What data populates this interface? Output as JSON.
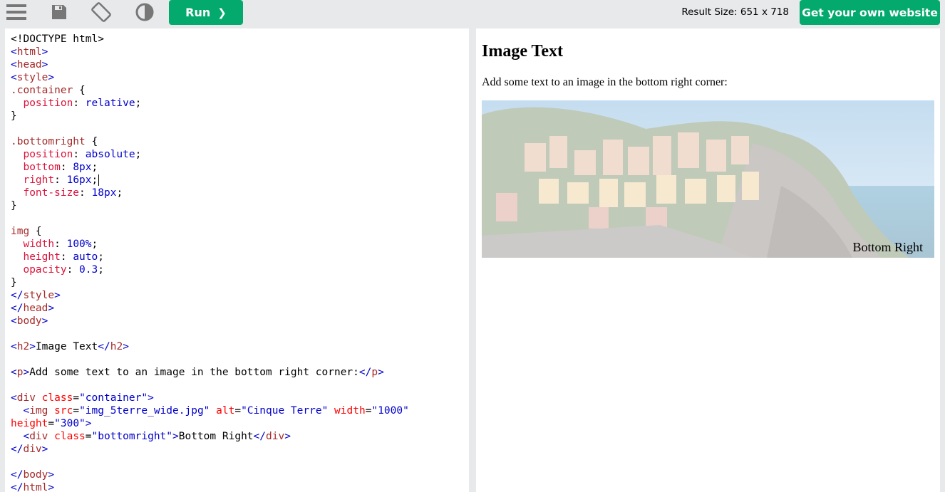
{
  "toolbar": {
    "menu_icon": "hamburger-menu-icon",
    "save_icon": "save-icon",
    "rotate_icon": "rotate-icon",
    "theme_icon": "contrast-icon",
    "run_label": "Run",
    "run_chevron": "❯",
    "result_size": "Result Size: 651 x 718",
    "get_website_label": "Get your own website",
    "accent_color": "#04aa6d"
  },
  "editor": {
    "lines": [
      [
        {
          "c": "",
          "t": "<!DOCTYPE html>"
        }
      ],
      [
        {
          "c": "b",
          "t": "<"
        },
        {
          "c": "t",
          "t": "html"
        },
        {
          "c": "b",
          "t": ">"
        }
      ],
      [
        {
          "c": "b",
          "t": "<"
        },
        {
          "c": "t",
          "t": "head"
        },
        {
          "c": "b",
          "t": ">"
        }
      ],
      [
        {
          "c": "b",
          "t": "<"
        },
        {
          "c": "t",
          "t": "style"
        },
        {
          "c": "b",
          "t": ">"
        }
      ],
      [
        {
          "c": "t",
          "t": ".container"
        },
        {
          "c": "",
          "t": " {"
        }
      ],
      [
        {
          "c": "",
          "t": "  "
        },
        {
          "c": "p",
          "t": "position"
        },
        {
          "c": "",
          "t": ": "
        },
        {
          "c": "b",
          "t": "relative"
        },
        {
          "c": "",
          "t": ";"
        }
      ],
      [
        {
          "c": "",
          "t": "}"
        }
      ],
      [
        {
          "c": "",
          "t": ""
        }
      ],
      [
        {
          "c": "t",
          "t": ".bottomright"
        },
        {
          "c": "",
          "t": " {"
        }
      ],
      [
        {
          "c": "",
          "t": "  "
        },
        {
          "c": "p",
          "t": "position"
        },
        {
          "c": "",
          "t": ": "
        },
        {
          "c": "b",
          "t": "absolute"
        },
        {
          "c": "",
          "t": ";"
        }
      ],
      [
        {
          "c": "",
          "t": "  "
        },
        {
          "c": "p",
          "t": "bottom"
        },
        {
          "c": "",
          "t": ": "
        },
        {
          "c": "b",
          "t": "8px"
        },
        {
          "c": "",
          "t": ";"
        }
      ],
      [
        {
          "c": "",
          "t": "  "
        },
        {
          "c": "p",
          "t": "right"
        },
        {
          "c": "",
          "t": ": "
        },
        {
          "c": "b",
          "t": "16px"
        },
        {
          "c": "",
          "t": ";"
        },
        {
          "c": "cursor",
          "t": ""
        }
      ],
      [
        {
          "c": "",
          "t": "  "
        },
        {
          "c": "p",
          "t": "font-size"
        },
        {
          "c": "",
          "t": ": "
        },
        {
          "c": "b",
          "t": "18px"
        },
        {
          "c": "",
          "t": ";"
        }
      ],
      [
        {
          "c": "",
          "t": "}"
        }
      ],
      [
        {
          "c": "",
          "t": ""
        }
      ],
      [
        {
          "c": "t",
          "t": "img"
        },
        {
          "c": "",
          "t": " {"
        }
      ],
      [
        {
          "c": "",
          "t": "  "
        },
        {
          "c": "p",
          "t": "width"
        },
        {
          "c": "",
          "t": ": "
        },
        {
          "c": "b",
          "t": "100%"
        },
        {
          "c": "",
          "t": ";"
        }
      ],
      [
        {
          "c": "",
          "t": "  "
        },
        {
          "c": "p",
          "t": "height"
        },
        {
          "c": "",
          "t": ": "
        },
        {
          "c": "b",
          "t": "auto"
        },
        {
          "c": "",
          "t": ";"
        }
      ],
      [
        {
          "c": "",
          "t": "  "
        },
        {
          "c": "p",
          "t": "opacity"
        },
        {
          "c": "",
          "t": ": "
        },
        {
          "c": "b",
          "t": "0.3"
        },
        {
          "c": "",
          "t": ";"
        }
      ],
      [
        {
          "c": "",
          "t": "}"
        }
      ],
      [
        {
          "c": "b",
          "t": "</"
        },
        {
          "c": "t",
          "t": "style"
        },
        {
          "c": "b",
          "t": ">"
        }
      ],
      [
        {
          "c": "b",
          "t": "</"
        },
        {
          "c": "t",
          "t": "head"
        },
        {
          "c": "b",
          "t": ">"
        }
      ],
      [
        {
          "c": "b",
          "t": "<"
        },
        {
          "c": "t",
          "t": "body"
        },
        {
          "c": "b",
          "t": ">"
        }
      ],
      [
        {
          "c": "",
          "t": ""
        }
      ],
      [
        {
          "c": "b",
          "t": "<"
        },
        {
          "c": "t",
          "t": "h2"
        },
        {
          "c": "b",
          "t": ">"
        },
        {
          "c": "",
          "t": "Image Text"
        },
        {
          "c": "b",
          "t": "</"
        },
        {
          "c": "t",
          "t": "h2"
        },
        {
          "c": "b",
          "t": ">"
        }
      ],
      [
        {
          "c": "",
          "t": ""
        }
      ],
      [
        {
          "c": "b",
          "t": "<"
        },
        {
          "c": "t",
          "t": "p"
        },
        {
          "c": "b",
          "t": ">"
        },
        {
          "c": "",
          "t": "Add some text to an image in the bottom right corner:"
        },
        {
          "c": "b",
          "t": "</"
        },
        {
          "c": "t",
          "t": "p"
        },
        {
          "c": "b",
          "t": ">"
        }
      ],
      [
        {
          "c": "",
          "t": ""
        }
      ],
      [
        {
          "c": "b",
          "t": "<"
        },
        {
          "c": "t",
          "t": "div"
        },
        {
          "c": "",
          "t": " "
        },
        {
          "c": "a",
          "t": "class"
        },
        {
          "c": "",
          "t": "="
        },
        {
          "c": "b",
          "t": "\"container\""
        },
        {
          "c": "b",
          "t": ">"
        }
      ],
      [
        {
          "c": "",
          "t": "  "
        },
        {
          "c": "b",
          "t": "<"
        },
        {
          "c": "t",
          "t": "img"
        },
        {
          "c": "",
          "t": " "
        },
        {
          "c": "a",
          "t": "src"
        },
        {
          "c": "",
          "t": "="
        },
        {
          "c": "b",
          "t": "\"img_5terre_wide.jpg\""
        },
        {
          "c": "",
          "t": " "
        },
        {
          "c": "a",
          "t": "alt"
        },
        {
          "c": "",
          "t": "="
        },
        {
          "c": "b",
          "t": "\"Cinque Terre\""
        },
        {
          "c": "",
          "t": " "
        },
        {
          "c": "a",
          "t": "width"
        },
        {
          "c": "",
          "t": "="
        },
        {
          "c": "b",
          "t": "\"1000\""
        }
      ],
      [
        {
          "c": "a",
          "t": "height"
        },
        {
          "c": "",
          "t": "="
        },
        {
          "c": "b",
          "t": "\"300\""
        },
        {
          "c": "b",
          "t": ">"
        }
      ],
      [
        {
          "c": "",
          "t": "  "
        },
        {
          "c": "b",
          "t": "<"
        },
        {
          "c": "t",
          "t": "div"
        },
        {
          "c": "",
          "t": " "
        },
        {
          "c": "a",
          "t": "class"
        },
        {
          "c": "",
          "t": "="
        },
        {
          "c": "b",
          "t": "\"bottomright\""
        },
        {
          "c": "b",
          "t": ">"
        },
        {
          "c": "",
          "t": "Bottom Right"
        },
        {
          "c": "b",
          "t": "</"
        },
        {
          "c": "t",
          "t": "div"
        },
        {
          "c": "b",
          "t": ">"
        }
      ],
      [
        {
          "c": "b",
          "t": "</"
        },
        {
          "c": "t",
          "t": "div"
        },
        {
          "c": "b",
          "t": ">"
        }
      ],
      [
        {
          "c": "",
          "t": ""
        }
      ],
      [
        {
          "c": "b",
          "t": "</"
        },
        {
          "c": "t",
          "t": "body"
        },
        {
          "c": "b",
          "t": ">"
        }
      ],
      [
        {
          "c": "b",
          "t": "</"
        },
        {
          "c": "t",
          "t": "html"
        },
        {
          "c": "b",
          "t": ">"
        }
      ]
    ]
  },
  "result": {
    "heading": "Image Text",
    "paragraph": "Add some text to an image in the bottom right corner:",
    "image_alt": "Cinque Terre",
    "overlay_text": "Bottom Right"
  }
}
